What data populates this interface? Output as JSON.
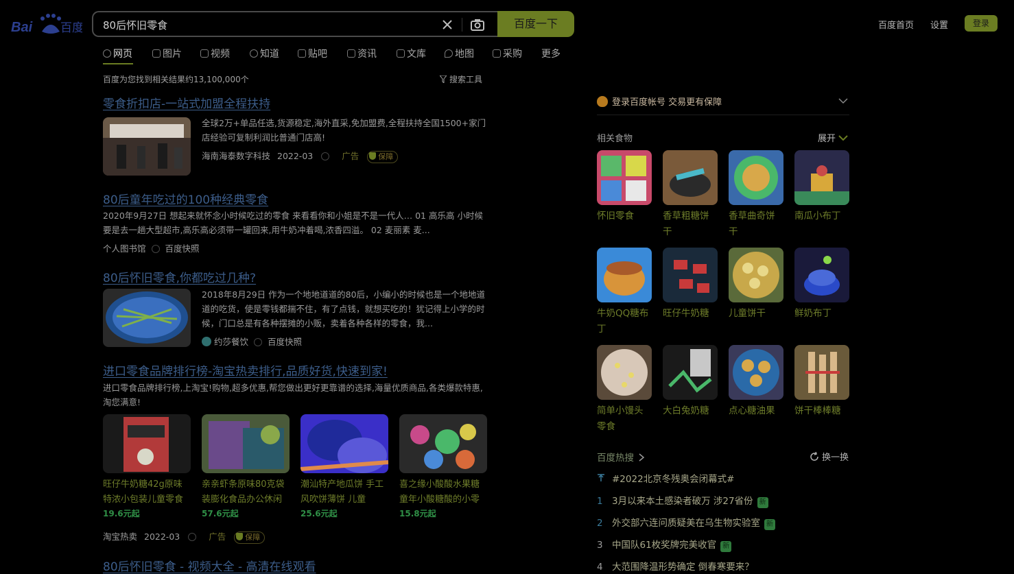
{
  "header": {
    "logo_text": "Bai百度",
    "query": "80后怀旧零食",
    "search_button": "百度一下",
    "links": [
      "百度首页",
      "设置"
    ],
    "login_button": "登录"
  },
  "tabs": [
    "网页",
    "图片",
    "视频",
    "知道",
    "贴吧",
    "资讯",
    "文库",
    "地图",
    "采购",
    "更多"
  ],
  "result_count": "百度为您找到相关结果约13,100,000个",
  "search_tools": "搜索工具",
  "results": [
    {
      "title": "零食折扣店-一站式加盟全程扶持",
      "snippet": "全球2万+单品任选,货源稳定,海外直采,免加盟费,全程扶持全国1500+家门店经验可复制利润比普通门店高!",
      "source": "海南海泰数字科技",
      "date": "2022-03",
      "ad_label": "广告",
      "badge": "保障"
    },
    {
      "title": "80后童年吃过的100种经典零食",
      "snippet": "2020年9月27日 想起来就怀念小时候吃过的零食 来看看你和小姐是不是一代人… 01 高乐高 小时候要是去一趟大型超市,高乐高必须带一罐回来,用牛奶冲着喝,浓香四溢。 02 麦丽素 麦...",
      "source": "个人图书馆",
      "cache": "百度快照"
    },
    {
      "title": "80后怀旧零食,你都吃过几种?",
      "snippet": "2018年8月29日 作为一个地地道道的80后，小编小的时候也是一个地地道道的吃货，使是零钱都揣不住，有了点钱，就想买吃的！犹记得上小学的时候，门口总是有各种摆摊的小贩，卖着各种各样的零食，我...",
      "source": "约莎餐饮",
      "cache": "百度快照"
    },
    {
      "title": "进口零食品牌排行榜-淘宝热卖排行,品质好货,快速到家!",
      "snippet": "进口零食品牌排行榜,上淘宝!购物,超多优惠,帮您做出更好更靠谱的选择,海量优质商品,各类爆款特惠,淘您满意!",
      "source": "淘宝热卖",
      "date": "2022-03",
      "ad_label": "广告",
      "badge": "保障",
      "products": [
        {
          "title": "旺仔牛奶糖42g原味特浓小包装儿童零食",
          "price": "19.6元起"
        },
        {
          "title": "亲亲虾条原味80克袋装膨化食品办公休闲",
          "price": "57.6元起"
        },
        {
          "title": "潮汕特产地瓜饼 手工风吹饼薄饼 儿童",
          "price": "25.6元起"
        },
        {
          "title": "喜之缘小酸酸水果糖童年小酸糖酸的小零",
          "price": "15.8元起"
        }
      ]
    },
    {
      "title": "80后怀旧零食 - 视频大全 - 高清在线观看"
    }
  ],
  "right": {
    "guard": "登录百度帐号 交易更有保障",
    "related_title": "相关食物",
    "expand": "展开",
    "foods": [
      "怀旧零食",
      "香草粗糖饼干",
      "香草曲奇饼干",
      "南瓜小布丁",
      "牛奶QQ糖布丁",
      "旺仔牛奶糖",
      "儿童饼干",
      "鲜奶布丁",
      "简单小馒头零食",
      "大白兔奶糖",
      "点心糖油果",
      "饼干棒棒糖"
    ],
    "hot_title": "百度热搜",
    "refresh": "换一换",
    "hot": [
      {
        "rank": "",
        "text": "#2022北京冬残奥会闭幕式#",
        "tag": ""
      },
      {
        "rank": "1",
        "text": "3月以来本土感染者破万 涉27省份",
        "tag": "新"
      },
      {
        "rank": "2",
        "text": "外交部六连问质疑美在乌生物实验室",
        "tag": "新"
      },
      {
        "rank": "3",
        "text": "中国队61枚奖牌完美收官",
        "tag": "新"
      },
      {
        "rank": "4",
        "text": "大范围降温形势确定 倒春寒要来？",
        "tag": ""
      }
    ]
  }
}
